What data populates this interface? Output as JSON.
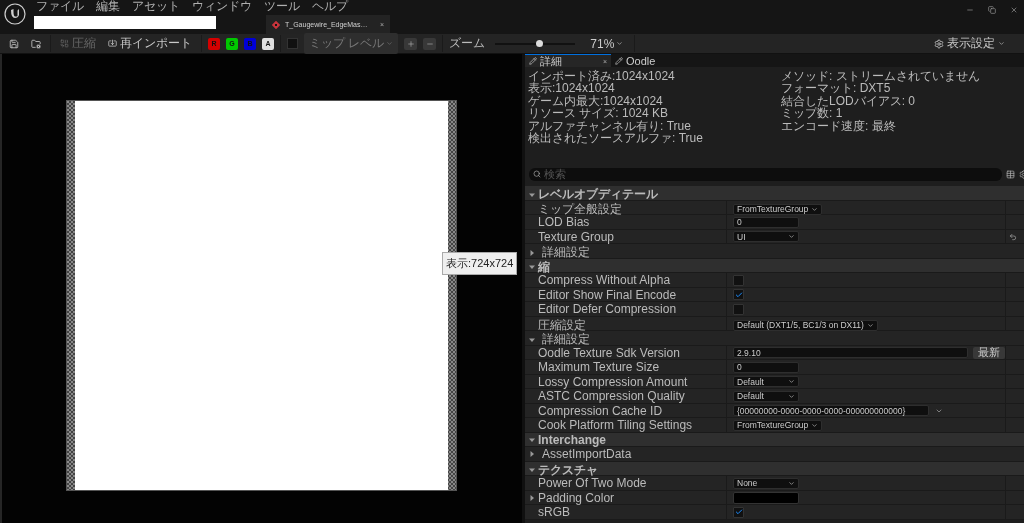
{
  "menu": [
    "ファイル",
    "編集",
    "アセット",
    "ウィンドウ",
    "ツール",
    "ヘルプ"
  ],
  "asset_tab": {
    "title": "T_Gaugewire_EdgeMas…",
    "close": "×",
    "selected": true
  },
  "toolbar": {
    "buttons": [
      {
        "kind": "save"
      },
      {
        "kind": "browse"
      },
      {
        "kind": "compress",
        "label": "圧縮",
        "disabled": true
      },
      {
        "kind": "reimport",
        "label": "再インポート",
        "disabled": false
      }
    ],
    "channels": [
      {
        "label": "R",
        "color": "#d40000",
        "selected": true
      },
      {
        "label": "G",
        "color": "#00c800",
        "selected": true
      },
      {
        "label": "B",
        "color": "#0000d8",
        "selected": true
      },
      {
        "label": "A",
        "color": "#e0e0e0",
        "selected": true
      }
    ],
    "mip_checkbox": {
      "checked": false
    },
    "mip_dropdown": {
      "label": "ミップ レベル",
      "disabled": true
    },
    "zoom": {
      "label": "ズーム",
      "level": 0.55,
      "value": "71%"
    },
    "view_settings": "表示設定"
  },
  "viewport": {
    "tooltip": "表示:724x724"
  },
  "details": {
    "tabs": [
      {
        "label": "詳細",
        "selected": true,
        "close": "×"
      },
      {
        "label": "Oodle",
        "selected": false
      }
    ],
    "info_left": [
      "インポート済み:1024x1024",
      "表示:1024x1024",
      "ゲーム内最大:1024x1024",
      "リソース サイズ: 1024 KB",
      "アルファチャンネル有り: True",
      "検出されたソースアルファ: True"
    ],
    "info_right": [
      "メソッド: ストリームされていません",
      "フォーマット: DXT5",
      "結合したLODバイアス: 0",
      "ミップ数: 1",
      "エンコード速度: 最終"
    ],
    "search": {
      "placeholder": "検索"
    },
    "rows": [
      {
        "kind": "section",
        "label": "レベルオブディテール",
        "expanded": true
      },
      {
        "kind": "dropdown",
        "label": "ミップ全般設定",
        "value": "FromTextureGroup"
      },
      {
        "kind": "number",
        "label": "LOD Bias",
        "value": "0"
      },
      {
        "kind": "dropdown",
        "label": "Texture Group",
        "value": "UI",
        "wide": true,
        "reset": true
      },
      {
        "kind": "group",
        "label": "詳細設定",
        "expanded": false
      },
      {
        "kind": "section",
        "label": "縮",
        "expanded": true
      },
      {
        "kind": "checkbox",
        "label": "Compress Without Alpha",
        "checked": false
      },
      {
        "kind": "checkbox",
        "label": "Editor Show Final Encode",
        "checked": true
      },
      {
        "kind": "checkbox",
        "label": "Editor Defer Compression",
        "checked": false
      },
      {
        "kind": "dropdown",
        "label": "圧縮設定",
        "value": "Default (DXT1/5, BC1/3 on DX11)"
      },
      {
        "kind": "group",
        "label": "詳細設定",
        "expanded": true
      },
      {
        "kind": "text",
        "label": "Oodle Texture Sdk Version",
        "value": "2.9.10",
        "button": "最新"
      },
      {
        "kind": "number",
        "label": "Maximum Texture Size",
        "value": "0"
      },
      {
        "kind": "dropdown",
        "label": "Lossy Compression Amount",
        "value": "Default",
        "wide": true
      },
      {
        "kind": "dropdown",
        "label": "ASTC Compression Quality",
        "value": "Default",
        "wide": true
      },
      {
        "kind": "guid",
        "label": "Compression Cache ID",
        "value": "{00000000-0000-0000-0000-000000000000}"
      },
      {
        "kind": "dropdown",
        "label": "Cook Platform Tiling Settings",
        "value": "FromTextureGroup"
      },
      {
        "kind": "section",
        "label": "Interchange",
        "expanded": true
      },
      {
        "kind": "expander",
        "label": "AssetImportData",
        "expanded": false
      },
      {
        "kind": "section",
        "label": "テクスチャ",
        "expanded": true
      },
      {
        "kind": "dropdown",
        "label": "Power Of Two Mode",
        "value": "None",
        "wide": true
      },
      {
        "kind": "color",
        "label": "Padding Color",
        "color": "#000000",
        "expanded": false
      },
      {
        "kind": "checkbox",
        "label": "sRGB",
        "checked": true
      }
    ]
  }
}
